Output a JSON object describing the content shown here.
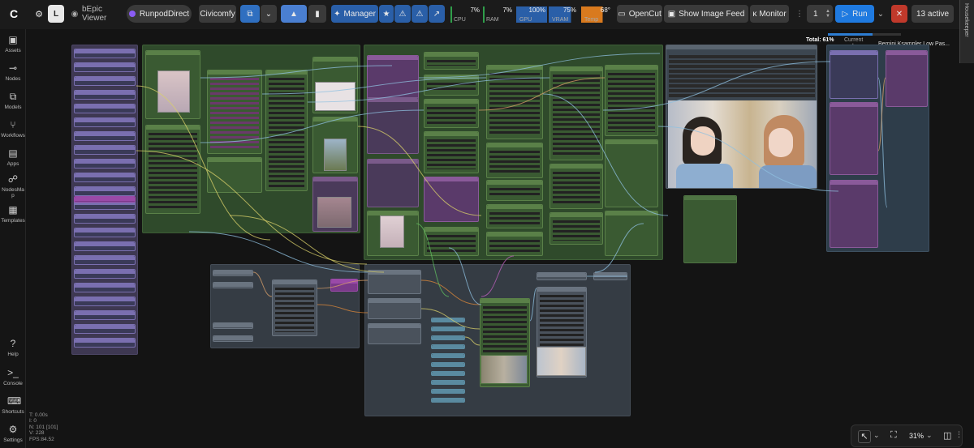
{
  "topbar": {
    "workflow_name": "bEpic Viewer",
    "runpod_label": "RunpodDirect",
    "civicomfy_label": "Civicomfy",
    "manager_label": "Manager",
    "stats": [
      {
        "label": "CPU",
        "value": "7%"
      },
      {
        "label": "RAM",
        "value": "7%"
      },
      {
        "label": "GPU",
        "value": "100%"
      },
      {
        "label": "VRAM",
        "value": "75%"
      },
      {
        "label": "Temp",
        "value": "68°"
      }
    ],
    "opencut_label": "OpenCut",
    "image_feed_label": "Show Image Feed",
    "monitor_label": "Monitor",
    "queue_count": "1",
    "run_label": "Run",
    "active_label": "13 active",
    "housekeeper_label": "Housekeeper"
  },
  "progress": {
    "total_label": "Total: 61%",
    "total_fraction": 0.61,
    "current_label": "Current node:",
    "current_node": "Bernini Ksampler Low Pas..."
  },
  "sidebar": {
    "items": [
      {
        "icon": "assets-icon",
        "label": "Assets"
      },
      {
        "icon": "nodes-icon",
        "label": "Nodes"
      },
      {
        "icon": "models-icon",
        "label": "Models"
      },
      {
        "icon": "workflows-icon",
        "label": "Workflows"
      },
      {
        "icon": "apps-icon",
        "label": "Apps"
      },
      {
        "icon": "nodesmap-icon",
        "label": "NodesMa\np"
      },
      {
        "icon": "templates-icon",
        "label": "Templates"
      }
    ],
    "bottom": [
      {
        "icon": "help-icon",
        "label": "Help"
      },
      {
        "icon": "console-icon",
        "label": "Console"
      },
      {
        "icon": "shortcuts-icon",
        "label": "Shortcuts"
      },
      {
        "icon": "settings-icon",
        "label": "Settings"
      }
    ]
  },
  "canvas_stats": {
    "t": "T: 0.00s",
    "i": "I: 0",
    "n": "N: 101 [101]",
    "v": "V: 228",
    "fps": "FPS:84.52"
  },
  "zoom": {
    "value": "31%"
  },
  "colors": {
    "accent": "#2d7dd2",
    "run_blue": "#1f7ae0",
    "stop_red": "#c0392b",
    "node_green": "#3a5a32",
    "group_purple": "#5a4a7a",
    "group_grey": "#3b4550"
  }
}
